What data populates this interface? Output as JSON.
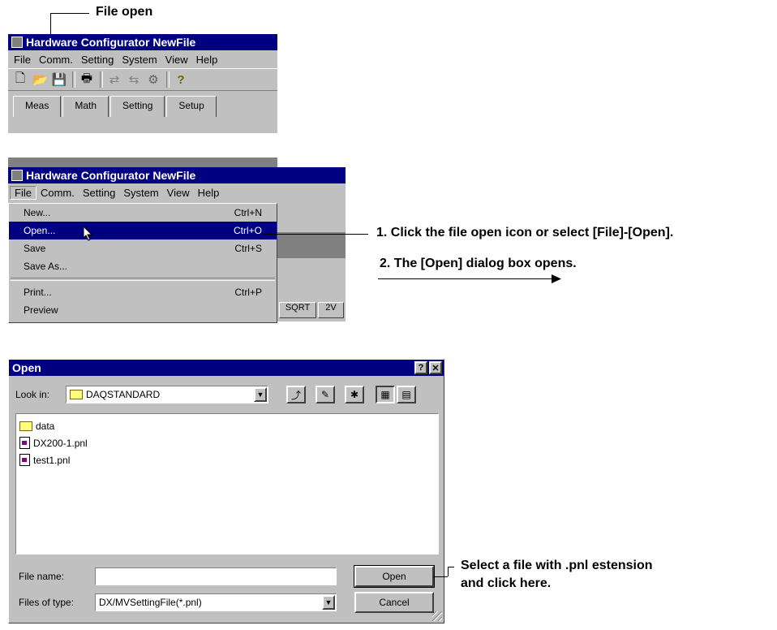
{
  "annotations": {
    "file_open": "File open",
    "step1": "1. Click the file open icon or select [File]-[Open].",
    "step2": "2. The [Open] dialog box opens.",
    "select_file_line1": "Select a file with .pnl estension",
    "select_file_line2": "and click here."
  },
  "window1": {
    "title": "Hardware Configurator NewFile",
    "menu": [
      "File",
      "Comm.",
      "Setting",
      "System",
      "View",
      "Help"
    ],
    "tabs": [
      "Meas",
      "Math",
      "Setting",
      "Setup"
    ]
  },
  "window2": {
    "title": "Hardware Configurator NewFile",
    "menu": [
      "File",
      "Comm.",
      "Setting",
      "System",
      "View",
      "Help"
    ],
    "file_menu": [
      {
        "label": "New...",
        "shortcut": "Ctrl+N"
      },
      {
        "label": "Open...",
        "shortcut": "Ctrl+O"
      },
      {
        "label": "Save",
        "shortcut": "Ctrl+S"
      },
      {
        "label": "Save As...",
        "shortcut": ""
      },
      {
        "label": "Print...",
        "shortcut": "Ctrl+P"
      },
      {
        "label": "Preview",
        "shortcut": ""
      }
    ],
    "background_cells": [
      "SQRT",
      "2V"
    ]
  },
  "dialog": {
    "title": "Open",
    "help_button": "?",
    "close_button": "✕",
    "look_in_label": "Look in:",
    "look_in_value": "DAQSTANDARD",
    "files": [
      {
        "name": "data",
        "icon": "folder-icon"
      },
      {
        "name": "DX200-1.pnl",
        "icon": "pnl-file-icon"
      },
      {
        "name": "test1.pnl",
        "icon": "pnl-file-icon"
      }
    ],
    "file_name_label": "File name:",
    "file_name_value": "",
    "files_of_type_label": "Files of type:",
    "files_of_type_value": "DX/MVSettingFile(*.pnl)",
    "open_button": "Open",
    "cancel_button": "Cancel"
  }
}
